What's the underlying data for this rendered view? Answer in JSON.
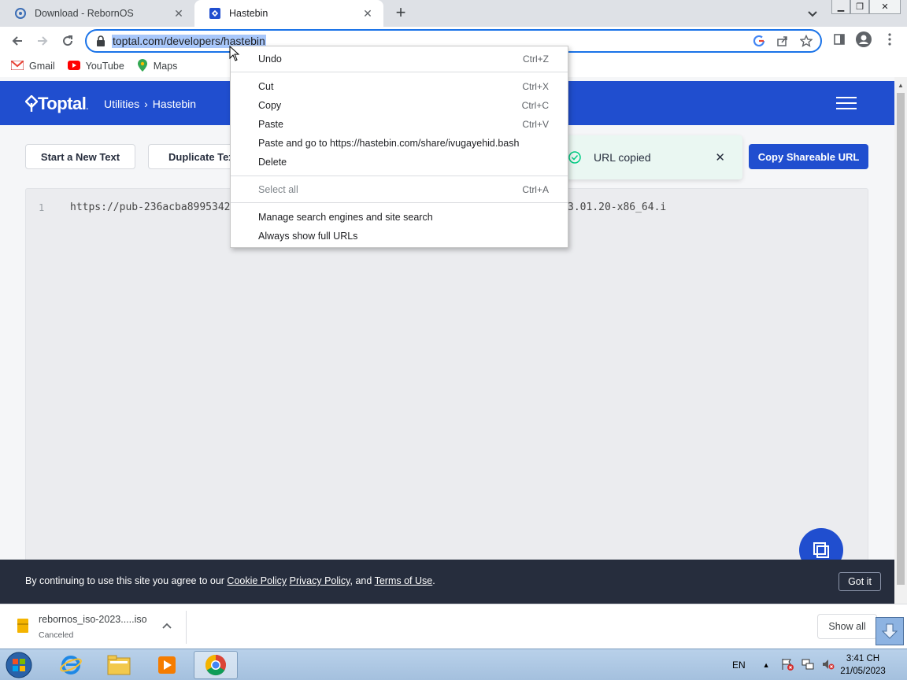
{
  "browser": {
    "tabs": [
      {
        "title": "Download - RebornOS",
        "active": false
      },
      {
        "title": "Hastebin",
        "active": true
      }
    ],
    "url": "toptal.com/developers/hastebin",
    "bookmarks": [
      "Gmail",
      "YouTube",
      "Maps"
    ]
  },
  "site": {
    "logo": "Toptal",
    "breadcrumb": [
      "Utilities",
      "Hastebin"
    ],
    "buttons": {
      "new_text": "Start a New Text",
      "duplicate": "Duplicate Text",
      "copy_url": "Copy Shareable URL"
    },
    "toast": "URL copied",
    "editor": {
      "line_number": "1",
      "code_start": "https://pub-236acba8995342",
      "code_end": "3.01.20-x86_64.i"
    },
    "cookie": {
      "prefix": "By continuing to use this site you agree to our",
      "cookie_policy": "Cookie Policy",
      "privacy_policy": "Privacy Policy",
      "and": ", and",
      "terms": "Terms of Use",
      "suffix": ".",
      "button": "Got it"
    }
  },
  "context_menu": {
    "undo": {
      "label": "Undo",
      "shortcut": "Ctrl+Z"
    },
    "cut": {
      "label": "Cut",
      "shortcut": "Ctrl+X"
    },
    "copy": {
      "label": "Copy",
      "shortcut": "Ctrl+C"
    },
    "paste": {
      "label": "Paste",
      "shortcut": "Ctrl+V"
    },
    "paste_go": {
      "label": "Paste and go to https://hastebin.com/share/ivugayehid.bash"
    },
    "delete": {
      "label": "Delete"
    },
    "select_all": {
      "label": "Select all",
      "shortcut": "Ctrl+A"
    },
    "manage_search": {
      "label": "Manage search engines and site search"
    },
    "show_urls": {
      "label": "Always show full URLs"
    }
  },
  "downloads": {
    "filename": "rebornos_iso-2023.....iso",
    "status": "Canceled",
    "show_all": "Show all"
  },
  "taskbar": {
    "lang": "EN",
    "time": "3:41 CH",
    "date": "21/05/2023"
  },
  "colors": {
    "brand": "#204ecf",
    "cookie_bar": "#262d3d",
    "toast_bg": "#eaf7f2",
    "selection": "#a8c7fa"
  }
}
